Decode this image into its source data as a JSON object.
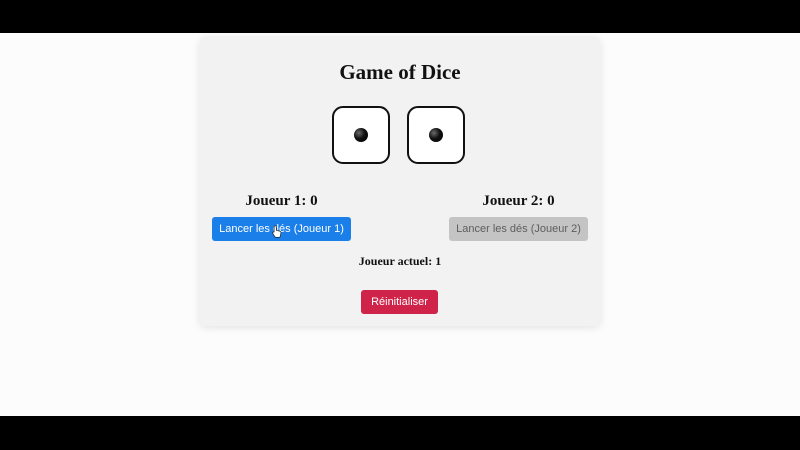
{
  "game": {
    "title": "Game of Dice",
    "dice": [
      {
        "value": 1,
        "icon": "die-face-one"
      },
      {
        "value": 1,
        "icon": "die-face-one"
      }
    ],
    "players": [
      {
        "score_text": "Joueur 1: 0",
        "roll_label": "Lancer les dés (Joueur 1)",
        "enabled": true
      },
      {
        "score_text": "Joueur 2: 0",
        "roll_label": "Lancer les dés (Joueur 2)",
        "enabled": false
      }
    ],
    "current_player_text": "Joueur actuel: 1",
    "reset_label": "Réinitialiser"
  },
  "colors": {
    "primary_button": "#1a7fe8",
    "disabled_button": "#c4c4c4",
    "reset_button": "#d0234a",
    "card_background": "#f2f2f3"
  }
}
